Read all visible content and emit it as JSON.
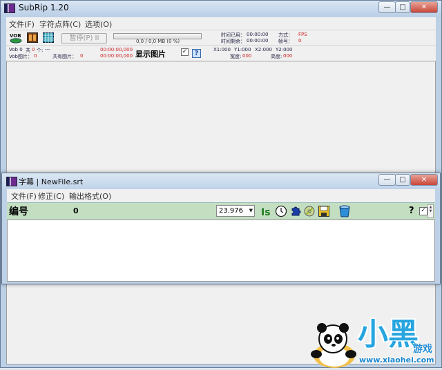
{
  "main": {
    "title": "SubRip 1.20",
    "menu": [
      "文件(F)",
      "字符点阵(C)",
      "选项(O)"
    ],
    "controls": {
      "minimize": "—",
      "maximize": "□",
      "close": "✕"
    },
    "toolbar": {
      "pause_label": "暂停(P) II",
      "progress_text": "0,0 / 0,0 MB (0 %)",
      "progress_fraction": 0,
      "time_used_label": "时间已用：",
      "time_used_value": "00:00:00",
      "time_left_label": "时间剩余：",
      "time_left_value": "00:00:00",
      "mode_label": "方式：",
      "mode_value": "FPS",
      "frame_label": "帧号：",
      "frame_value": "0"
    },
    "info": {
      "vob_label": "Vob 0",
      "total_label": "共",
      "total_value": "0",
      "count_label": "个:",
      "count_value": "---",
      "vob_pic_label": "Vob图片：",
      "vob_pic_value": "0",
      "total_pic_label": "共有图片：",
      "total_pic_value": "0",
      "time1": "00:00:00,000",
      "time2": "00:00:00,000",
      "show_picture": "显示图片",
      "show_picture_checked": "✓",
      "help": "?",
      "x1": "X1:000",
      "y1": "Y1:000",
      "x2": "X2:000",
      "y2": "Y2:000",
      "width_label": "宽度:",
      "width_value": "000",
      "height_label": "高度:",
      "height_value": "000"
    }
  },
  "subtitle_window": {
    "title": "字幕 | NewFile.srt",
    "menu": [
      "文件(F)",
      "修正(C)",
      "输出格式(O)"
    ],
    "number_label": "编号",
    "number_value": "0",
    "fps_value": "23.976",
    "help": "?",
    "check": "✓"
  },
  "logo": {
    "text": "小黑",
    "game": "游戏",
    "url": "www.xiaohei.com"
  },
  "colors": {
    "accent_green": "#c4dec2",
    "window_frame": "#bcd0e6",
    "logo_blue": "#27a5e0"
  }
}
